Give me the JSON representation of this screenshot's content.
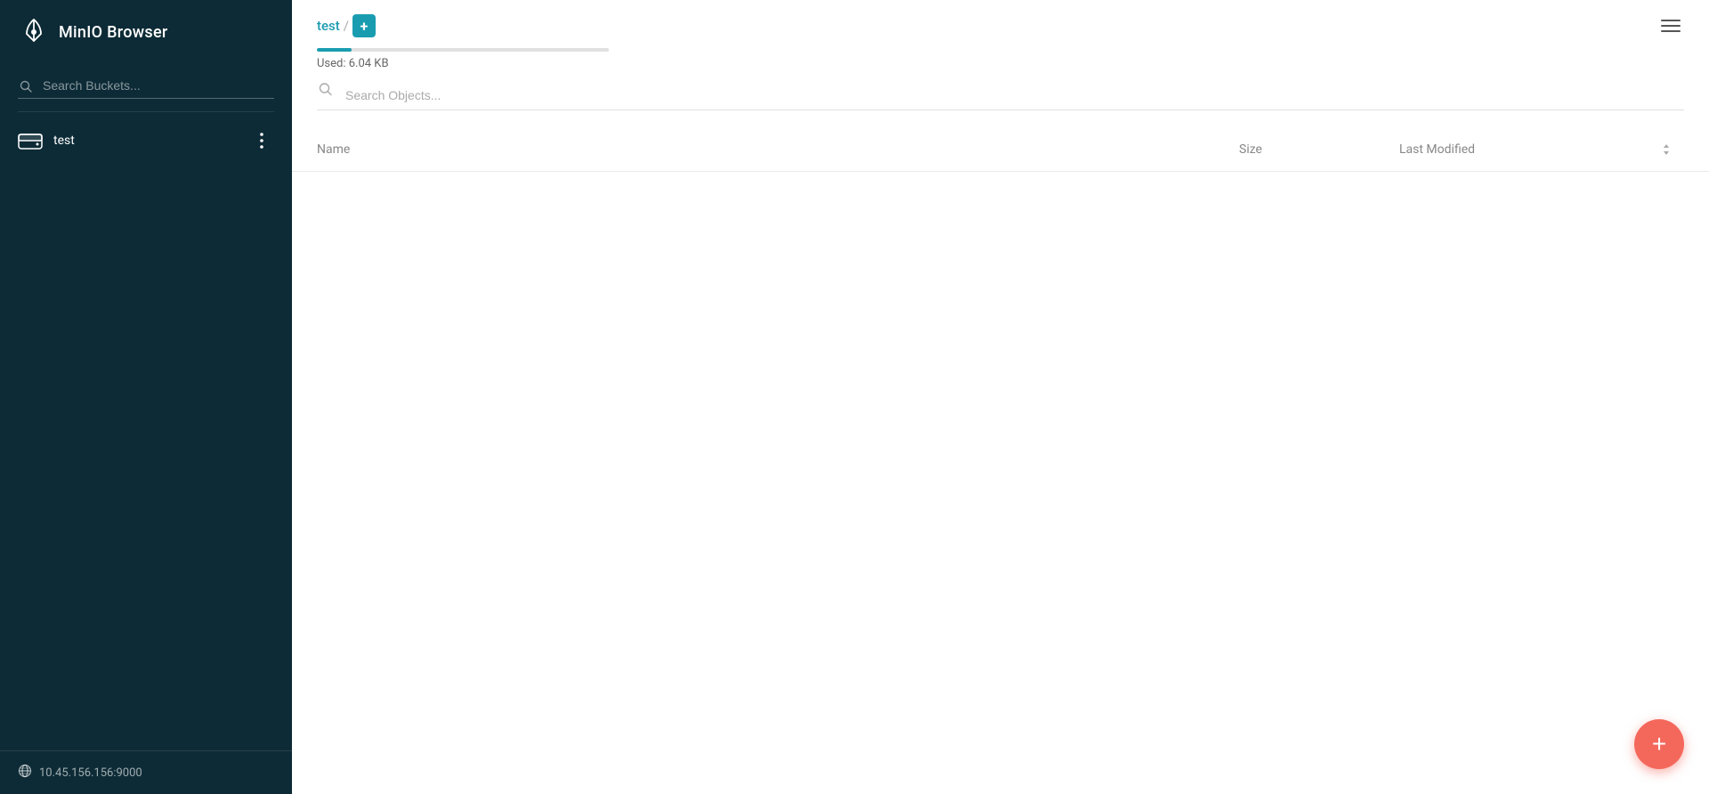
{
  "app": {
    "title": "MinIO Browser"
  },
  "sidebar": {
    "search_placeholder": "Search Buckets...",
    "footer_address": "10.45.156.156:9000",
    "buckets": [
      {
        "name": "test"
      }
    ]
  },
  "main": {
    "breadcrumb": {
      "bucket": "test",
      "separator": "/",
      "add_tooltip": "+"
    },
    "storage": {
      "used_label": "Used: 6.04 KB",
      "fill_percent": 12
    },
    "search": {
      "placeholder": "Search Objects..."
    },
    "table": {
      "col_name": "Name",
      "col_size": "Size",
      "col_last_modified": "Last Modified"
    },
    "fab_label": "+"
  }
}
